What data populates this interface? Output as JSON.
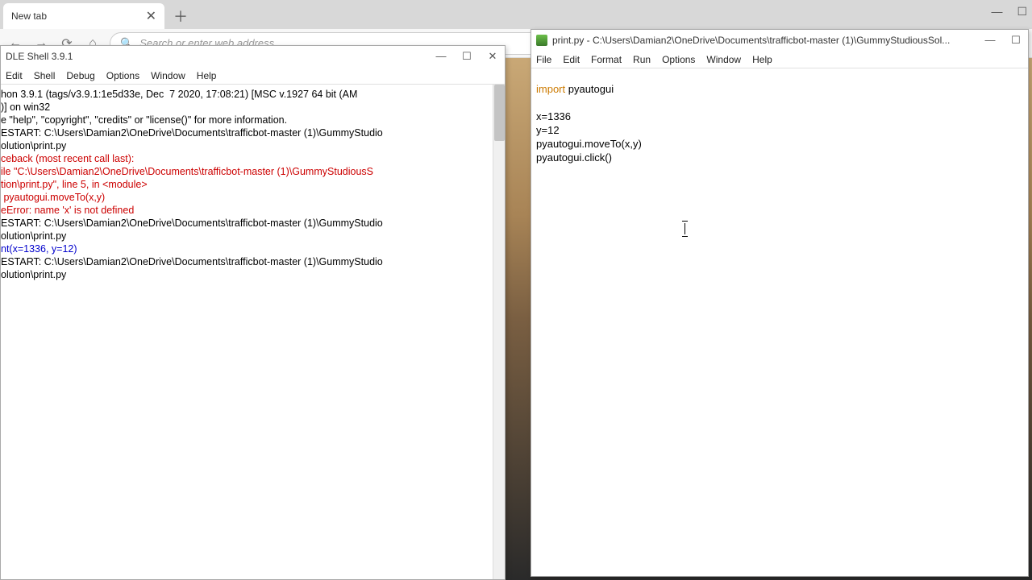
{
  "browser": {
    "tab_label": "New tab",
    "search_placeholder": "Search or enter web address"
  },
  "shell": {
    "title": "DLE Shell 3.9.1",
    "menus": [
      "Edit",
      "Shell",
      "Debug",
      "Options",
      "Window",
      "Help"
    ],
    "lines": [
      {
        "cls": "",
        "t": "hon 3.9.1 (tags/v3.9.1:1e5d33e, Dec  7 2020, 17:08:21) [MSC v.1927 64 bit (AM"
      },
      {
        "cls": "",
        "t": ")] on win32"
      },
      {
        "cls": "",
        "t": "e \"help\", \"copyright\", \"credits\" or \"license()\" for more information."
      },
      {
        "cls": "",
        "t": ""
      },
      {
        "cls": "",
        "t": "ESTART: C:\\Users\\Damian2\\OneDrive\\Documents\\trafficbot-master (1)\\GummyStudio"
      },
      {
        "cls": "",
        "t": "olution\\print.py"
      },
      {
        "cls": "red",
        "t": "ceback (most recent call last):"
      },
      {
        "cls": "red",
        "t": "ile \"C:\\Users\\Damian2\\OneDrive\\Documents\\trafficbot-master (1)\\GummyStudiousS"
      },
      {
        "cls": "red",
        "t": "tion\\print.py\", line 5, in <module>"
      },
      {
        "cls": "red",
        "t": " pyautogui.moveTo(x,y)"
      },
      {
        "cls": "red",
        "t": "eError: name 'x' is not defined"
      },
      {
        "cls": "",
        "t": ""
      },
      {
        "cls": "",
        "t": "ESTART: C:\\Users\\Damian2\\OneDrive\\Documents\\trafficbot-master (1)\\GummyStudio"
      },
      {
        "cls": "",
        "t": "olution\\print.py"
      },
      {
        "cls": "blue",
        "t": "nt(x=1336, y=12)"
      },
      {
        "cls": "",
        "t": ""
      },
      {
        "cls": "",
        "t": "ESTART: C:\\Users\\Damian2\\OneDrive\\Documents\\trafficbot-master (1)\\GummyStudio"
      },
      {
        "cls": "",
        "t": "olution\\print.py"
      }
    ]
  },
  "editor": {
    "title": "print.py - C:\\Users\\Damian2\\OneDrive\\Documents\\trafficbot-master (1)\\GummyStudiousSol...",
    "menus": [
      "File",
      "Edit",
      "Format",
      "Run",
      "Options",
      "Window",
      "Help"
    ],
    "code": {
      "kw": "import",
      "l1": " pyautogui",
      "blank": "",
      "l3": "x=1336",
      "l4": "y=12",
      "l5": "pyautogui.moveTo(x,y)",
      "l6": "pyautogui.click()"
    }
  },
  "glyph": {
    "close": "✕",
    "plus": "＋",
    "back": "←",
    "fwd": "→",
    "reload": "⟳",
    "home": "⌂",
    "search": "🔍",
    "min": "—",
    "max": "☐"
  }
}
